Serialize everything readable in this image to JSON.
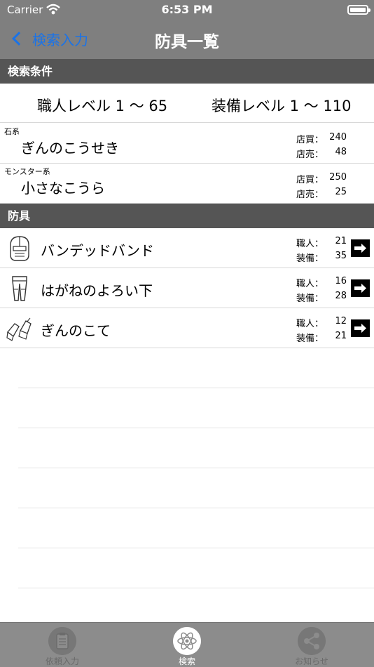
{
  "status_bar": {
    "carrier": "Carrier",
    "time": "6:53 PM"
  },
  "nav": {
    "back_label": "検索入力",
    "title": "防具一覧"
  },
  "search_section": {
    "header": "検索条件",
    "craft_level": "職人レベル 1 〜 65",
    "equip_level": "装備レベル 1 〜 110"
  },
  "materials": [
    {
      "category": "石系",
      "name": "ぎんのこうせき",
      "buy_label": "店買：",
      "buy": "240",
      "sell_label": "店売：",
      "sell": "48"
    },
    {
      "category": "モンスター系",
      "name": "小さなこうら",
      "buy_label": "店買：",
      "buy": "250",
      "sell_label": "店売：",
      "sell": "25"
    }
  ],
  "armor_section": {
    "header": "防具",
    "items": [
      {
        "icon": "helmet-icon",
        "name": "バンデッドバンド",
        "craft_label": "職人：",
        "craft": "21",
        "equip_label": "装備：",
        "equip": "35"
      },
      {
        "icon": "leg-armor-icon",
        "name": "はがねのよろい下",
        "craft_label": "職人：",
        "craft": "16",
        "equip_label": "装備：",
        "equip": "28"
      },
      {
        "icon": "gauntlet-icon",
        "name": "ぎんのこて",
        "craft_label": "職人：",
        "craft": "12",
        "equip_label": "装備：",
        "equip": "21"
      }
    ]
  },
  "tabs": [
    {
      "label": "依頼入力",
      "icon": "clipboard-icon",
      "active": false
    },
    {
      "label": "検索",
      "icon": "atom-icon",
      "active": true
    },
    {
      "label": "お知らせ",
      "icon": "share-icon",
      "active": false
    }
  ],
  "colors": {
    "accent": "#1a73e8",
    "header_bg": "#555555",
    "nav_bg": "#7f7f7f",
    "tab_bg": "#8c8c8c"
  }
}
